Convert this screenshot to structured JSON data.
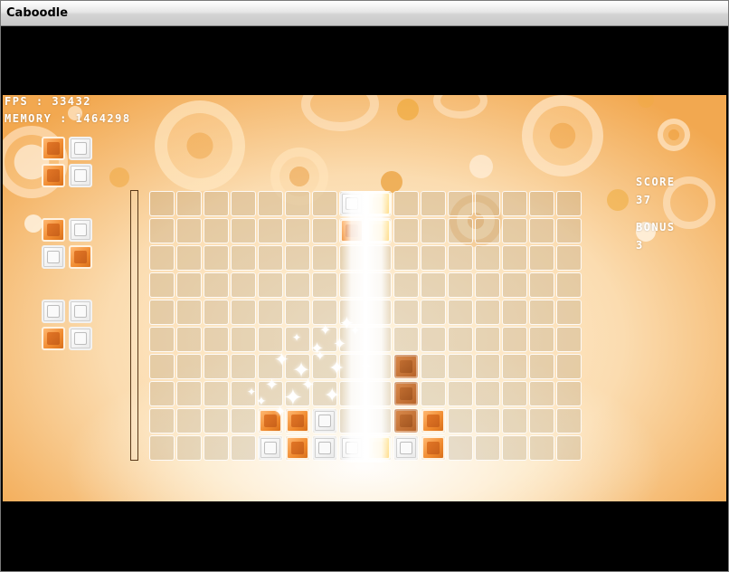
{
  "window": {
    "title": "Caboodle"
  },
  "hud": {
    "fps": "FPS : 33432",
    "memory": "MEMORY : 1464298",
    "score_label": "SCORE",
    "score_value": "37",
    "bonus_label": "BONUS",
    "bonus_value": "3"
  },
  "colors": {
    "accent_orange": "#f08a2e",
    "background_orange": "#f2a850",
    "block_white": "#ffffff"
  },
  "grid": {
    "columns": 16,
    "rows": 10
  },
  "queue": [
    [
      "orange",
      "white",
      "orange",
      "white"
    ],
    [
      "orange",
      "white",
      "white",
      "orange"
    ],
    [
      "white",
      "white",
      "orange",
      "white"
    ]
  ],
  "falling_piece": [
    {
      "col": 7,
      "row": 0,
      "color": "white"
    },
    {
      "col": 8,
      "row": 0,
      "color": "yellow"
    },
    {
      "col": 7,
      "row": 1,
      "color": "orange"
    },
    {
      "col": 8,
      "row": 1,
      "color": "yellow"
    }
  ],
  "placed_blocks": [
    {
      "col": 9,
      "row": 6,
      "color": "dark"
    },
    {
      "col": 9,
      "row": 7,
      "color": "dark"
    },
    {
      "col": 9,
      "row": 8,
      "color": "dark"
    },
    {
      "col": 10,
      "row": 8,
      "color": "orange"
    },
    {
      "col": 4,
      "row": 8,
      "color": "orange"
    },
    {
      "col": 5,
      "row": 8,
      "color": "orange"
    },
    {
      "col": 6,
      "row": 8,
      "color": "white"
    },
    {
      "col": 4,
      "row": 9,
      "color": "white"
    },
    {
      "col": 5,
      "row": 9,
      "color": "orange"
    },
    {
      "col": 6,
      "row": 9,
      "color": "white"
    },
    {
      "col": 7,
      "row": 9,
      "color": "white"
    },
    {
      "col": 8,
      "row": 9,
      "color": "yellow"
    },
    {
      "col": 9,
      "row": 9,
      "color": "white"
    },
    {
      "col": 10,
      "row": 9,
      "color": "orange"
    }
  ]
}
